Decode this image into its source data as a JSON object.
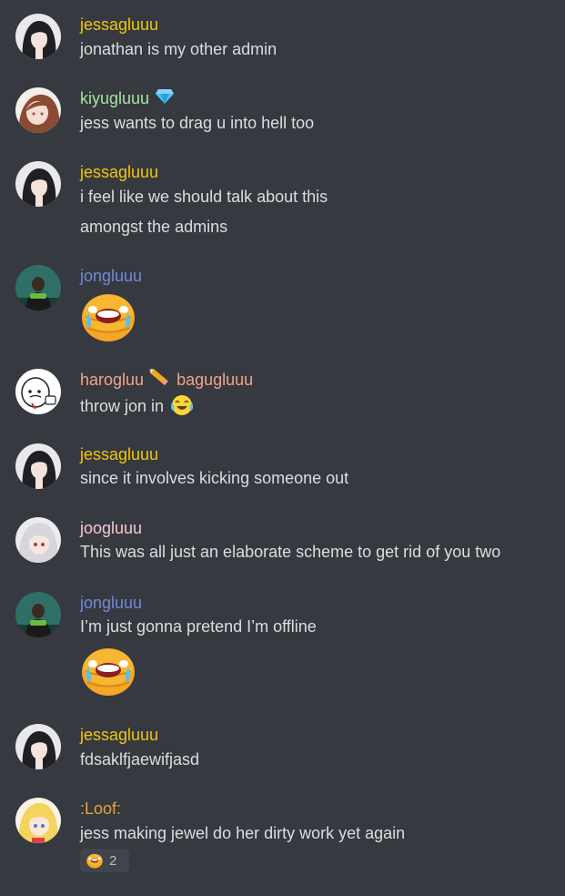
{
  "colors": {
    "background": "#36393f",
    "text": "#dcddde",
    "jessagluuu": "#f1c40f",
    "kiyugluuu": "#a5e3a3",
    "jongluuu": "#7289da",
    "harogluu": "#f0a488",
    "joogluuu": "#f6c6d1",
    "loof": "#e9a23b"
  },
  "messages": [
    {
      "author": "jessagluuu",
      "lines": [
        "jonathan is my other admin"
      ]
    },
    {
      "author": "kiyugluuu",
      "badge_icon": "gem-icon",
      "lines": [
        "jess wants to drag u into hell too"
      ]
    },
    {
      "author": "jessagluuu",
      "lines": [
        "i feel like we should talk about this",
        "amongst the admins"
      ]
    },
    {
      "author": "jongluuu",
      "emoji": "crying-pancake-emoji"
    },
    {
      "author": "harogluu",
      "separator_icon": "pencil-icon",
      "author2": "bagugluuu",
      "lines": [
        "throw jon in"
      ],
      "inline_emoji": "joy-emoji"
    },
    {
      "author": "jessagluuu",
      "lines": [
        "since it involves kicking someone out"
      ]
    },
    {
      "author": "joogluuu",
      "lines": [
        "This was all just an elaborate scheme to get rid of you two"
      ]
    },
    {
      "author": "jongluuu",
      "lines": [
        "I’m just gonna pretend I’m offline"
      ],
      "emoji": "crying-pancake-emoji"
    },
    {
      "author": "jessagluuu",
      "lines": [
        "fdsaklfjaewifjasd"
      ]
    },
    {
      "author": ":Loof:",
      "lines": [
        "jess making jewel do her dirty work yet again"
      ],
      "reaction": {
        "emoji": "crying-pancake-emoji",
        "count": "2"
      }
    }
  ]
}
